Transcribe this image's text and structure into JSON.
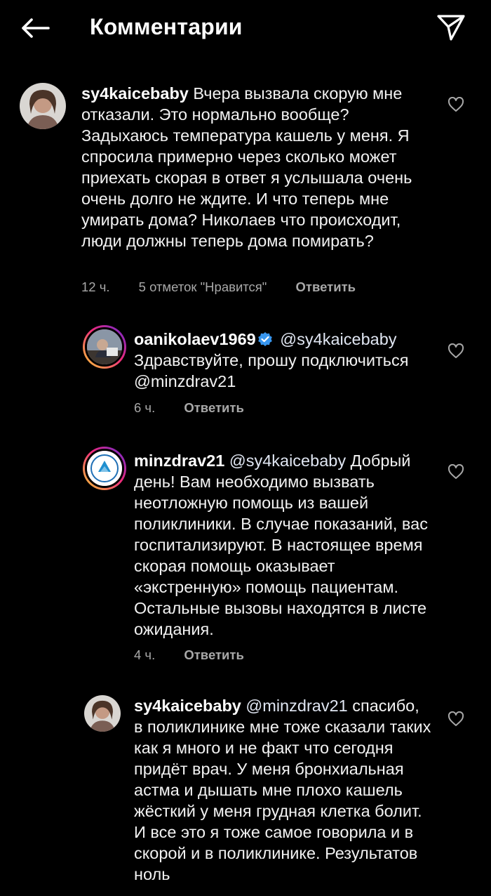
{
  "header": {
    "title": "Комментарии"
  },
  "comments": [
    {
      "username": "sy4kaicebaby",
      "text": "Вчера вызвала скорую мне отказали. Это нормально вообще? Задыхаюсь температура кашель у меня. Я спросила примерно через сколько может приехать скорая в ответ я услышала очень очень долго не ждите. И что теперь мне умирать дома? Николаев что происходит, люди должны теперь дома помирать?",
      "time": "12 ч.",
      "likes": "5 отметок \"Нравится\"",
      "reply_label": "Ответить"
    },
    {
      "username": "oanikolaev1969",
      "mention": "@sy4kaicebaby",
      "text": "Здравствуйте, прошу подключиться @minzdrav21",
      "time": "6 ч.",
      "reply_label": "Ответить"
    },
    {
      "username": "minzdrav21",
      "mention": "@sy4kaicebaby",
      "text": "Добрый день! Вам необходимо вызвать неотложную помощь из вашей поликлиники. В случае показаний, вас госпитализируют. В настоящее время скорая помощь оказывает «экстренную» помощь пациентам. Остальные вызовы находятся в листе ожидания.",
      "time": "4 ч.",
      "reply_label": "Ответить"
    },
    {
      "username": "sy4kaicebaby",
      "mention": "@minzdrav21",
      "text": "спасибо, в поликлинике мне тоже сказали таких как я много и не факт что сегодня придёт врач. У меня бронхиальная астма и дышать мне плохо кашель жёсткий у меня грудная клетка болит. И все это я тоже самое говорила и в скорой и в поликлинике. Результатов ноль"
    }
  ],
  "colors": {
    "background": "#000000",
    "text": "#f2f2f2",
    "meta": "#a8a8a8",
    "verified": "#3897f0"
  }
}
